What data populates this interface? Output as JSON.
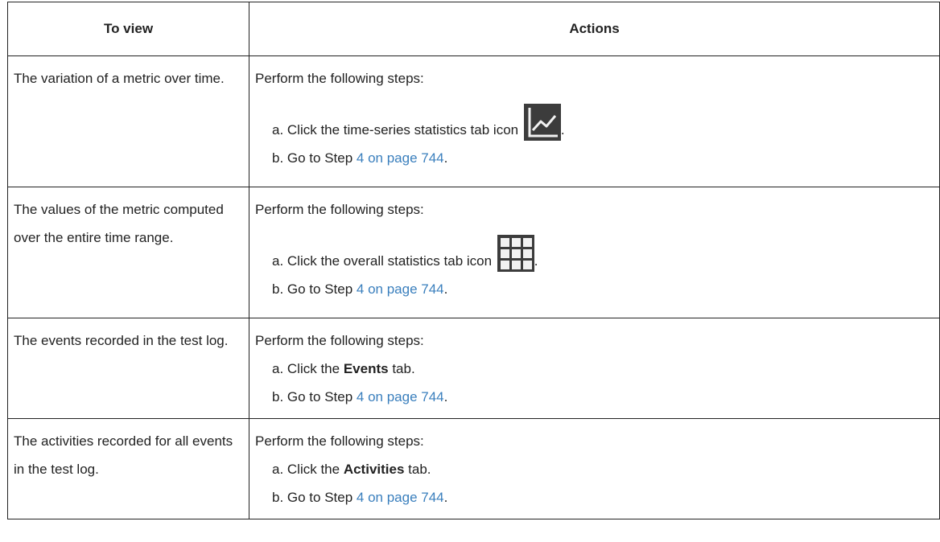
{
  "headers": {
    "to_view": "To view",
    "actions": "Actions"
  },
  "rows": [
    {
      "view": "The variation of a metric over time.",
      "intro": "Perform the following steps:",
      "a_prefix": "a. Click the time-series statistics tab icon",
      "a_suffix": ".",
      "icon": "time-series-chart-icon",
      "b_prefix": "b. Go to Step",
      "b_link": "4 on page 744",
      "b_suffix": "."
    },
    {
      "view": "The values of the metric computed over the entire time range.",
      "intro": "Perform the following steps:",
      "a_prefix": "a. Click the overall statistics tab icon",
      "a_suffix": ".",
      "icon": "grid-table-icon",
      "b_prefix": "b. Go to Step",
      "b_link": "4 on page 744",
      "b_suffix": "."
    },
    {
      "view": "The events recorded in the test log.",
      "intro": "Perform the following steps:",
      "a_prefix": "a. Click the",
      "a_bold": "Events",
      "a_suffix": "tab.",
      "b_prefix": "b. Go to Step",
      "b_link": "4 on page 744",
      "b_suffix": "."
    },
    {
      "view": "The activities recorded for all events in the test log.",
      "intro": "Perform the following steps:",
      "a_prefix": "a. Click the",
      "a_bold": "Activities",
      "a_suffix": "tab.",
      "b_prefix": "b. Go to Step",
      "b_link": "4 on page 744",
      "b_suffix": "."
    }
  ],
  "colors": {
    "link": "#3a7fbd",
    "border": "#222222",
    "icon_bg": "#3c3c3c"
  }
}
